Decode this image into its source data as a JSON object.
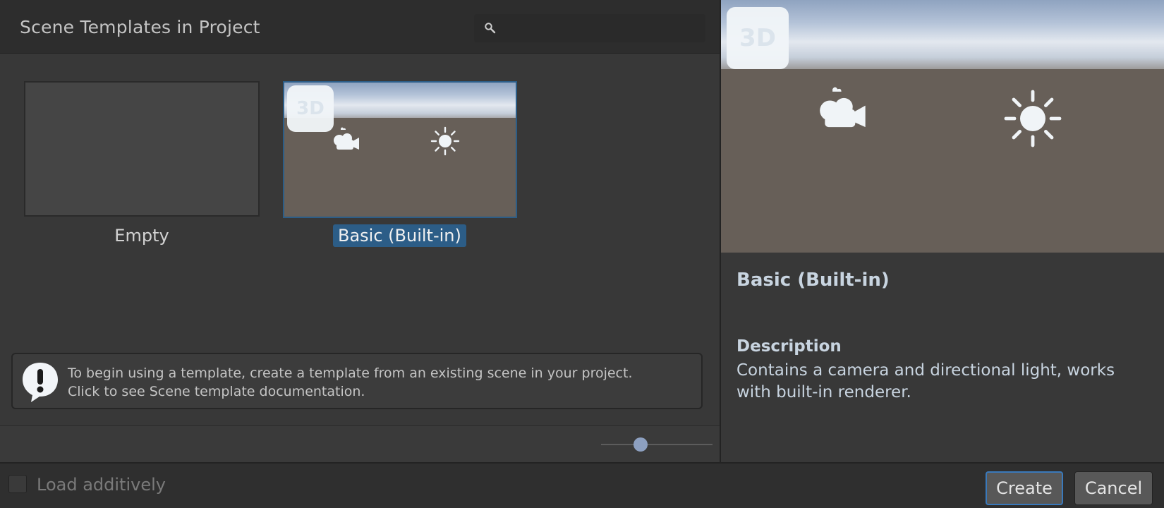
{
  "header": {
    "title": "Scene Templates in Project",
    "search_placeholder": ""
  },
  "templates": [
    {
      "label": "Empty",
      "selected": false
    },
    {
      "label": "Basic (Built-in)",
      "selected": true,
      "badge": "3D"
    }
  ],
  "help": {
    "line1": "To begin using a template, create a template from an existing scene in your project.",
    "line2": "Click to see Scene template documentation."
  },
  "zoom_slider": {
    "value_fraction": 0.35
  },
  "preview": {
    "badge": "3D",
    "title": "Basic (Built-in)",
    "description_heading": "Description",
    "description": "Contains a camera and directional light, works with built-in renderer."
  },
  "footer": {
    "load_additively_label": "Load additively",
    "load_additively_checked": false,
    "create_label": "Create",
    "cancel_label": "Cancel"
  },
  "colors": {
    "selection": "#2c5d87",
    "create_border": "#3a79bb",
    "ground": "#675f58"
  },
  "icons": {
    "search": "magnifier-icon",
    "help": "exclamation-speech-bubble-icon",
    "camera": "camera-icon",
    "light": "directional-light-sun-icon"
  }
}
